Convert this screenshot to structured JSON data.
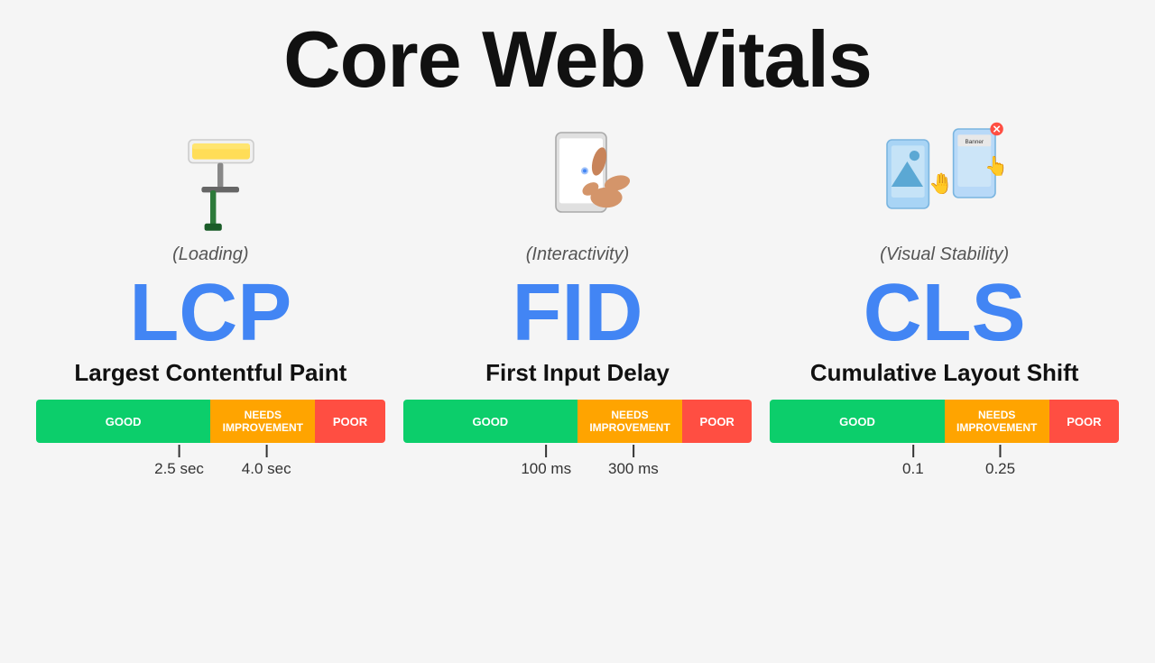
{
  "page": {
    "title": "Core Web Vitals"
  },
  "metrics": [
    {
      "id": "lcp",
      "icon": "paint-roller",
      "category": "(Loading)",
      "acronym": "LCP",
      "name": "Largest Contentful Paint",
      "bar": {
        "good_label": "GOOD",
        "needs_label": "NEEDS\nIMPROVEMENT",
        "poor_label": "POOR"
      },
      "marker1_label": "2.5 sec",
      "marker2_label": "4.0 sec",
      "marker1_pct": 41,
      "marker2_pct": 66
    },
    {
      "id": "fid",
      "icon": "hand-tap",
      "category": "(Interactivity)",
      "acronym": "FID",
      "name": "First Input Delay",
      "bar": {
        "good_label": "GOOD",
        "needs_label": "NEEDS\nIMPROVEMENT",
        "poor_label": "POOR"
      },
      "marker1_label": "100 ms",
      "marker2_label": "300 ms",
      "marker1_pct": 41,
      "marker2_pct": 66
    },
    {
      "id": "cls",
      "icon": "layout-shift",
      "category": "(Visual Stability)",
      "acronym": "CLS",
      "name": "Cumulative Layout Shift",
      "bar": {
        "good_label": "GOOD",
        "needs_label": "NEEDS\nIMPROVEMENT",
        "poor_label": "POOR"
      },
      "marker1_label": "0.1",
      "marker2_label": "0.25",
      "marker1_pct": 41,
      "marker2_pct": 66
    }
  ],
  "colors": {
    "good": "#0cce6b",
    "needs": "#ffa400",
    "poor": "#ff4e42",
    "acronym": "#4285f4"
  }
}
